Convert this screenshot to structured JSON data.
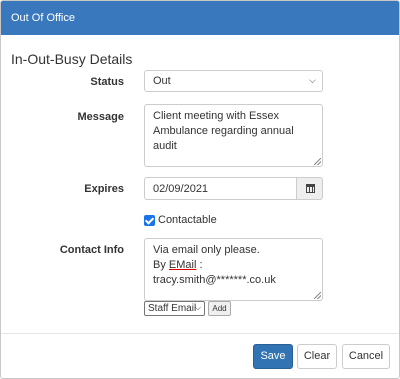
{
  "dialog": {
    "title": "Out Of Office"
  },
  "section": {
    "title": "In-Out-Busy Details"
  },
  "status": {
    "label": "Status",
    "value": "Out"
  },
  "message": {
    "label": "Message",
    "value": "Client meeting with Essex Ambulance regarding annual audit"
  },
  "expires": {
    "label": "Expires",
    "value": "02/09/2021"
  },
  "contactable": {
    "label": "Contactable",
    "checked": true
  },
  "contact_info": {
    "label": "Contact Info",
    "line1": "Via email only please.",
    "line2_prefix": "By ",
    "line2_word": "EMail",
    "line2_rest": " : tracy.smith@*******.co.uk"
  },
  "contact_type": {
    "value": "Staff Email"
  },
  "buttons": {
    "add": "Add",
    "save": "Save",
    "clear": "Clear",
    "cancel": "Cancel"
  },
  "colors": {
    "header": "#3a78bd",
    "primary": "#3273b3"
  }
}
